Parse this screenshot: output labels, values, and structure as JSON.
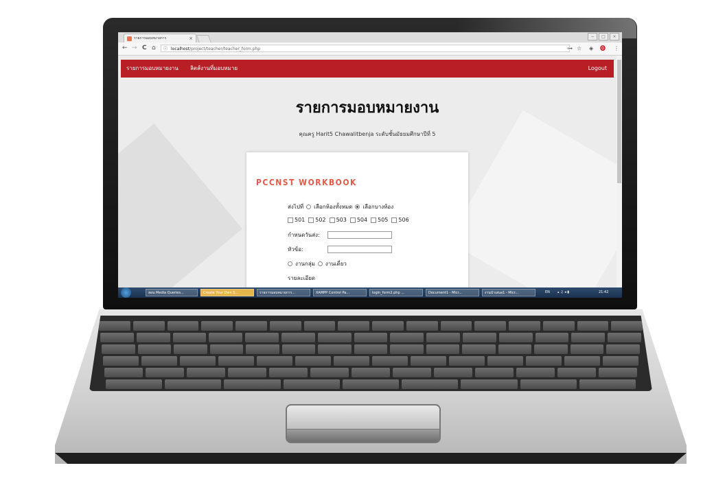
{
  "browser": {
    "tab_title": "รายการมอบหมายการ",
    "tab_close": "×",
    "url_host": "localhost",
    "url_path": "/project/teacher/teacher_form.php",
    "nav_back": "←",
    "nav_forward": "→",
    "nav_reload": "C",
    "nav_home": "⌂",
    "info_icon": "ⓘ",
    "key_icon": "⊶",
    "star_icon": "☆",
    "ext_icon": "◈",
    "pin_icon": "⓿",
    "menu_icon": "⋮",
    "win_min": "−",
    "win_max": "□",
    "win_close": "×"
  },
  "navbar": {
    "color": "#b71f25",
    "link1": "รายการมอบหมายงาน",
    "link2": "ลิตส์งานที่มอบหมาย",
    "logout": "Logout"
  },
  "main": {
    "title": "รายการมอบหมายงาน",
    "teacher_line": "คุณครู Harit5 Chawalitbenja ระดับชั้นมัธยมศึกษาปีที่ 5"
  },
  "form": {
    "brand": "PCCNST WORKBOOK",
    "brand_color": "#e35b4b",
    "send_to_label": "ส่งไปที่",
    "option_all": "เลือกห้องทั้งหมด",
    "option_some": "เลือกบางห้อง",
    "option_some_selected": true,
    "rooms": [
      "501",
      "502",
      "503",
      "504",
      "505",
      "506"
    ],
    "due_label": "กำหนดวันส่ง:",
    "topic_label": "หัวข้อ:",
    "group_label": "งานกลุ่ม",
    "single_label": "งานเดี่ยว",
    "detail_label": "รายละเอียด"
  },
  "taskbar": {
    "items": [
      {
        "label": "สอน Media Queries...",
        "active": false
      },
      {
        "label": "Create Your Own S...",
        "active": true
      },
      {
        "label": "รายการมอบหมายการ...",
        "active": false
      },
      {
        "label": "XAMPP Control Pa...",
        "active": false
      },
      {
        "label": "login_form2.php ...",
        "active": false
      },
      {
        "label": "Document1 - Micr...",
        "active": false
      },
      {
        "label": "งานนำเสนอ1 - Micr...",
        "active": false
      }
    ],
    "lang": "EN",
    "time": "21:42"
  }
}
